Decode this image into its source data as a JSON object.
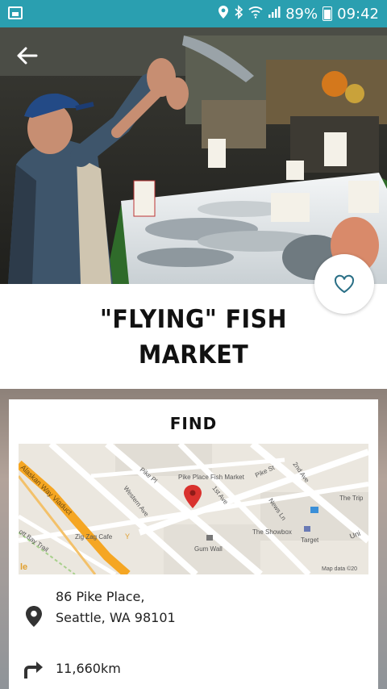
{
  "status_bar": {
    "battery": "89%",
    "time": "09:42"
  },
  "place": {
    "title_line1": "\"FLYING\" FISH",
    "title_line2": "MARKET"
  },
  "find": {
    "heading": "FIND",
    "address_line1": "86 Pike Place,",
    "address_line2": "Seattle, WA 98101",
    "distance": "11,660km"
  },
  "map": {
    "labels": {
      "fish_market": "Pike Place Fish Market",
      "pike_pl": "Pike Pl",
      "pike_st": "Pike St",
      "western_ave": "Western Ave",
      "first_ave": "1st Ave",
      "second_ave": "2nd Ave",
      "news_ln": "News Ln",
      "alaskan": "Alaskan Way Viaduct",
      "elliott": "ott Bay Trail",
      "zigzag": "Zig Zag Cafe",
      "gum_wall": "Gum Wall",
      "showbox": "The Showbox",
      "target": "Target",
      "the_trip": "The Trip",
      "univ": "Uni",
      "google": "le",
      "map_data": "Map data ©20"
    }
  },
  "colors": {
    "status_bar": "#2a9fb0",
    "pin": "#d9322e",
    "highway": "#f5a623"
  }
}
